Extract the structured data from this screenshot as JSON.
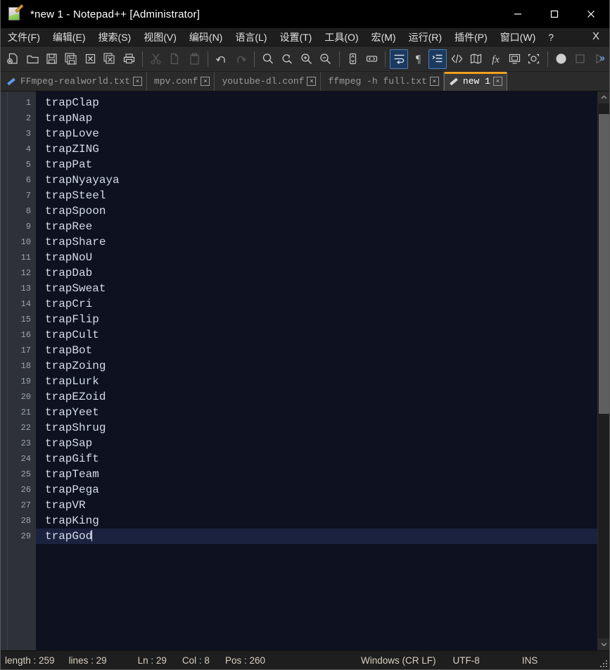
{
  "window": {
    "title": "*new 1 - Notepad++ [Administrator]",
    "app_icon": "notepad-plus-plus-icon",
    "controls": {
      "minimize": "minimize-icon",
      "maximize": "maximize-icon",
      "close": "close-icon"
    }
  },
  "menubar": {
    "items": [
      {
        "label": "文件(F)",
        "name": "menu-file"
      },
      {
        "label": "编辑(E)",
        "name": "menu-edit"
      },
      {
        "label": "搜索(S)",
        "name": "menu-search"
      },
      {
        "label": "视图(V)",
        "name": "menu-view"
      },
      {
        "label": "编码(N)",
        "name": "menu-encoding"
      },
      {
        "label": "语言(L)",
        "name": "menu-language"
      },
      {
        "label": "设置(T)",
        "name": "menu-settings"
      },
      {
        "label": "工具(O)",
        "name": "menu-tools"
      },
      {
        "label": "宏(M)",
        "name": "menu-macro"
      },
      {
        "label": "运行(R)",
        "name": "menu-run"
      },
      {
        "label": "插件(P)",
        "name": "menu-plugins"
      },
      {
        "label": "窗口(W)",
        "name": "menu-window"
      },
      {
        "label": "?",
        "name": "menu-help"
      }
    ],
    "close_document": "X"
  },
  "toolbar": {
    "icons": [
      "new-file-icon",
      "open-folder-icon",
      "save-icon",
      "save-all-icon",
      "close-file-icon",
      "close-all-files-icon",
      "print-icon",
      "cut-icon",
      "copy-icon",
      "paste-icon",
      "undo-icon",
      "redo-icon",
      "find-icon",
      "replace-icon",
      "zoom-in-icon",
      "zoom-out-icon",
      "sync-vertical-scroll-icon",
      "sync-horizontal-scroll-icon",
      "word-wrap-icon",
      "show-all-characters-icon",
      "indent-guide-icon",
      "tag-match-highlight-icon",
      "document-map-icon",
      "function-list-icon",
      "document-list-icon",
      "monitor-file-icon",
      "record-macro-icon",
      "stop-macro-icon",
      "play-macro-icon"
    ],
    "overflow": "»",
    "active_toggles": [
      "word-wrap-icon",
      "indent-guide-icon"
    ],
    "disabled": [
      "cut-icon",
      "copy-icon",
      "paste-icon",
      "redo-icon",
      "stop-macro-icon",
      "play-macro-icon"
    ],
    "accent_blue": "#1c3a5e"
  },
  "tabs": [
    {
      "label": "FFmpeg-realworld.txt",
      "active": false,
      "modified_icon": "pencil-icon",
      "close": "×"
    },
    {
      "label": "mpv.conf",
      "active": false,
      "modified_icon": "",
      "close": "×"
    },
    {
      "label": "youtube-dl.conf",
      "active": false,
      "modified_icon": "",
      "close": "×"
    },
    {
      "label": "ffmpeg -h full.txt",
      "active": false,
      "modified_icon": "",
      "close": "×"
    },
    {
      "label": "new 1",
      "active": true,
      "modified_icon": "pencil-icon",
      "close": "×"
    }
  ],
  "editor": {
    "active_line": 29,
    "lines": [
      "trapClap",
      "trapNap",
      "trapLove",
      "trapZING",
      "trapPat",
      "trapNyayaya",
      "trapSteel",
      "trapSpoon",
      "trapRee",
      "trapShare",
      "trapNoU",
      "trapDab",
      "trapSweat",
      "trapCri",
      "trapFlip",
      "trapCult",
      "trapBot",
      "trapZoing",
      "trapLurk",
      "trapEZoid",
      "trapYeet",
      "trapShrug",
      "trapSap",
      "trapGift",
      "trapTeam",
      "trapPega",
      "trapVR",
      "trapKing",
      "trapGod"
    ],
    "background": "#0d1120",
    "text_color": "#d6dce8",
    "gutter_background": "#2e3238",
    "current_line_highlight": "#1b2240"
  },
  "scrollbar": {
    "up_arrow": "chevron-up-icon",
    "down_arrow": "chevron-down-icon",
    "thumb_top_pct": 2,
    "thumb_height_pct": 56
  },
  "statusbar": {
    "length": "length : 259",
    "lines": "lines : 29",
    "ln": "Ln : 29",
    "col": "Col : 8",
    "pos": "Pos : 260",
    "eol": "Windows (CR LF)",
    "encoding": "UTF-8",
    "insert_mode": "INS"
  }
}
